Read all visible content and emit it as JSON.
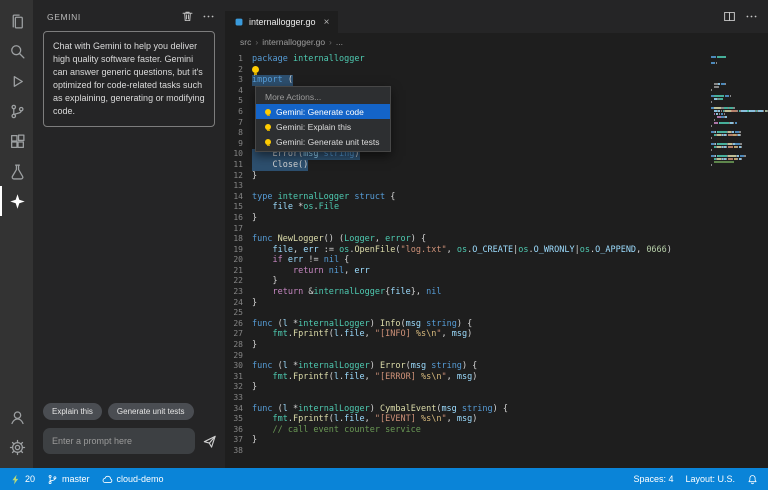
{
  "colors": {
    "status_bar": "#0a84d8",
    "menu_selection": "#1464c8",
    "selection": "#2d4f6e",
    "bulb": "#ffcc02",
    "bolt": "#b8d978",
    "go_badge": "#3a9bdc"
  },
  "activity_bar": {
    "items": [
      {
        "name": "explorer",
        "active": false
      },
      {
        "name": "search",
        "active": false
      },
      {
        "name": "run",
        "active": false
      },
      {
        "name": "source-control",
        "active": false
      },
      {
        "name": "extensions",
        "active": false
      },
      {
        "name": "testing",
        "active": false
      },
      {
        "name": "gemini-star",
        "active": true
      }
    ],
    "bottom_items": [
      {
        "name": "account",
        "active": false
      },
      {
        "name": "settings",
        "active": false
      }
    ]
  },
  "sidebar": {
    "title": "GEMINI",
    "header_icons": [
      "trash",
      "more"
    ],
    "description": "Chat with Gemini to help you deliver high quality software faster. Gemini can answer generic questions, but it's optimized for code-related tasks such as explaining, generating or modifying code.",
    "quick_actions": [
      "Explain this",
      "Generate unit tests"
    ],
    "prompt": {
      "placeholder": "Enter a prompt here",
      "value": ""
    }
  },
  "editor": {
    "tab": {
      "label": "internallogger.go",
      "close_glyph": "×"
    },
    "tab_actions": [
      "split-editor",
      "more"
    ],
    "breadcrumbs": [
      "src",
      "internallogger.go",
      "..."
    ],
    "context_menu": {
      "header": "More Actions...",
      "items": [
        {
          "label": "Gemini: Generate code",
          "icon": "lightbulb-icon",
          "selected": true
        },
        {
          "label": "Gemini: Explain this",
          "icon": "lightbulb-icon",
          "selected": false
        },
        {
          "label": "Gemini: Generate unit tests",
          "icon": "lightbulb-icon",
          "selected": false
        }
      ]
    },
    "code": {
      "language": "go",
      "lines": [
        {
          "tokens": [
            [
              "package",
              "kw"
            ],
            [
              " ",
              "pl"
            ],
            [
              "internallogger",
              "type"
            ]
          ]
        },
        {
          "bulb": true,
          "tokens": []
        },
        {
          "sel": true,
          "tokens": [
            [
              "import",
              "kw"
            ],
            [
              " (",
              "pl"
            ]
          ]
        },
        {
          "tokens": []
        },
        {
          "tokens": []
        },
        {
          "tokens": []
        },
        {
          "tokens": []
        },
        {
          "tokens": []
        },
        {
          "tokens": []
        },
        {
          "sel": true,
          "tokens": [
            [
              "    Error(",
              "pl"
            ],
            [
              "msg",
              "var"
            ],
            [
              " ",
              "pl"
            ],
            [
              "string",
              "kw"
            ],
            [
              ")",
              "pl"
            ]
          ]
        },
        {
          "sel": true,
          "tokens": [
            [
              "    Close()",
              "pl"
            ]
          ]
        },
        {
          "tokens": [
            [
              "}",
              "pl"
            ]
          ]
        },
        {
          "tokens": []
        },
        {
          "tokens": [
            [
              "type",
              "kw"
            ],
            [
              " ",
              "pl"
            ],
            [
              "internalLogger",
              "type"
            ],
            [
              " ",
              "pl"
            ],
            [
              "struct",
              "kw"
            ],
            [
              " {",
              "pl"
            ]
          ]
        },
        {
          "tokens": [
            [
              "    ",
              "pl"
            ],
            [
              "file",
              "var"
            ],
            [
              " *",
              "pl"
            ],
            [
              "os",
              "type"
            ],
            [
              ".",
              "pl"
            ],
            [
              "File",
              "type"
            ]
          ]
        },
        {
          "tokens": [
            [
              "}",
              "pl"
            ]
          ]
        },
        {
          "tokens": []
        },
        {
          "tokens": [
            [
              "func",
              "kw"
            ],
            [
              " ",
              "pl"
            ],
            [
              "NewLogger",
              "fn"
            ],
            [
              "() (",
              "pl"
            ],
            [
              "Logger",
              "type"
            ],
            [
              ", ",
              "pl"
            ],
            [
              "error",
              "type"
            ],
            [
              ") {",
              "pl"
            ]
          ]
        },
        {
          "tokens": [
            [
              "    ",
              "pl"
            ],
            [
              "file",
              "var"
            ],
            [
              ", ",
              "pl"
            ],
            [
              "err",
              "var"
            ],
            [
              " := ",
              "pl"
            ],
            [
              "os",
              "type"
            ],
            [
              ".",
              "pl"
            ],
            [
              "OpenFile",
              "fn"
            ],
            [
              "(",
              "pl"
            ],
            [
              "\"log.txt\"",
              "str"
            ],
            [
              ", ",
              "pl"
            ],
            [
              "os",
              "type"
            ],
            [
              ".",
              "pl"
            ],
            [
              "O_CREATE",
              "var"
            ],
            [
              "|",
              "pl"
            ],
            [
              "os",
              "type"
            ],
            [
              ".",
              "pl"
            ],
            [
              "O_WRONLY",
              "var"
            ],
            [
              "|",
              "pl"
            ],
            [
              "os",
              "type"
            ],
            [
              ".",
              "pl"
            ],
            [
              "O_APPEND",
              "var"
            ],
            [
              ", ",
              "pl"
            ],
            [
              "0666",
              "num"
            ],
            [
              ")",
              "pl"
            ]
          ]
        },
        {
          "tokens": [
            [
              "    ",
              "pl"
            ],
            [
              "if",
              "ctrl"
            ],
            [
              " ",
              "pl"
            ],
            [
              "err",
              "var"
            ],
            [
              " != ",
              "pl"
            ],
            [
              "nil",
              "kw"
            ],
            [
              " {",
              "pl"
            ]
          ]
        },
        {
          "tokens": [
            [
              "        ",
              "pl"
            ],
            [
              "return",
              "ctrl"
            ],
            [
              " ",
              "pl"
            ],
            [
              "nil",
              "kw"
            ],
            [
              ", ",
              "pl"
            ],
            [
              "err",
              "var"
            ]
          ]
        },
        {
          "tokens": [
            [
              "    }",
              "pl"
            ]
          ]
        },
        {
          "tokens": [
            [
              "    ",
              "pl"
            ],
            [
              "return",
              "ctrl"
            ],
            [
              " &",
              "pl"
            ],
            [
              "internalLogger",
              "type"
            ],
            [
              "{",
              "pl"
            ],
            [
              "file",
              "var"
            ],
            [
              "}, ",
              "pl"
            ],
            [
              "nil",
              "kw"
            ]
          ]
        },
        {
          "tokens": [
            [
              "}",
              "pl"
            ]
          ]
        },
        {
          "tokens": []
        },
        {
          "tokens": [
            [
              "func",
              "kw"
            ],
            [
              " (",
              "pl"
            ],
            [
              "l",
              "var"
            ],
            [
              " *",
              "pl"
            ],
            [
              "internalLogger",
              "type"
            ],
            [
              ") ",
              "pl"
            ],
            [
              "Info",
              "fn"
            ],
            [
              "(",
              "pl"
            ],
            [
              "msg",
              "var"
            ],
            [
              " ",
              "pl"
            ],
            [
              "string",
              "kw"
            ],
            [
              ") {",
              "pl"
            ]
          ]
        },
        {
          "tokens": [
            [
              "    ",
              "pl"
            ],
            [
              "fmt",
              "type"
            ],
            [
              ".",
              "pl"
            ],
            [
              "Fprintf",
              "fn"
            ],
            [
              "(",
              "pl"
            ],
            [
              "l",
              "var"
            ],
            [
              ".",
              "pl"
            ],
            [
              "file",
              "var"
            ],
            [
              ", ",
              "pl"
            ],
            [
              "\"[INFO] ",
              "str"
            ],
            [
              "%s\\n",
              "esc"
            ],
            [
              "\"",
              "str"
            ],
            [
              ", ",
              "pl"
            ],
            [
              "msg",
              "var"
            ],
            [
              ")",
              "pl"
            ]
          ]
        },
        {
          "tokens": [
            [
              "}",
              "pl"
            ]
          ]
        },
        {
          "tokens": []
        },
        {
          "tokens": [
            [
              "func",
              "kw"
            ],
            [
              " (",
              "pl"
            ],
            [
              "l",
              "var"
            ],
            [
              " *",
              "pl"
            ],
            [
              "internalLogger",
              "type"
            ],
            [
              ") ",
              "pl"
            ],
            [
              "Error",
              "fn"
            ],
            [
              "(",
              "pl"
            ],
            [
              "msg",
              "var"
            ],
            [
              " ",
              "pl"
            ],
            [
              "string",
              "kw"
            ],
            [
              ") {",
              "pl"
            ]
          ]
        },
        {
          "tokens": [
            [
              "    ",
              "pl"
            ],
            [
              "fmt",
              "type"
            ],
            [
              ".",
              "pl"
            ],
            [
              "Fprintf",
              "fn"
            ],
            [
              "(",
              "pl"
            ],
            [
              "l",
              "var"
            ],
            [
              ".",
              "pl"
            ],
            [
              "file",
              "var"
            ],
            [
              ", ",
              "pl"
            ],
            [
              "\"[ERROR] ",
              "str"
            ],
            [
              "%s\\n",
              "esc"
            ],
            [
              "\"",
              "str"
            ],
            [
              ", ",
              "pl"
            ],
            [
              "msg",
              "var"
            ],
            [
              ")",
              "pl"
            ]
          ]
        },
        {
          "tokens": [
            [
              "}",
              "pl"
            ]
          ]
        },
        {
          "tokens": []
        },
        {
          "tokens": [
            [
              "func",
              "kw"
            ],
            [
              " (",
              "pl"
            ],
            [
              "l",
              "var"
            ],
            [
              " *",
              "pl"
            ],
            [
              "internalLogger",
              "type"
            ],
            [
              ") ",
              "pl"
            ],
            [
              "CymbalEvent",
              "fn"
            ],
            [
              "(",
              "pl"
            ],
            [
              "msg",
              "var"
            ],
            [
              " ",
              "pl"
            ],
            [
              "string",
              "kw"
            ],
            [
              ") {",
              "pl"
            ]
          ]
        },
        {
          "tokens": [
            [
              "    ",
              "pl"
            ],
            [
              "fmt",
              "type"
            ],
            [
              ".",
              "pl"
            ],
            [
              "Fprintf",
              "fn"
            ],
            [
              "(",
              "pl"
            ],
            [
              "l",
              "var"
            ],
            [
              ".",
              "pl"
            ],
            [
              "file",
              "var"
            ],
            [
              ", ",
              "pl"
            ],
            [
              "\"[EVENT] ",
              "str"
            ],
            [
              "%s\\n",
              "esc"
            ],
            [
              "\"",
              "str"
            ],
            [
              ", ",
              "pl"
            ],
            [
              "msg",
              "var"
            ],
            [
              ")",
              "pl"
            ]
          ]
        },
        {
          "tokens": [
            [
              "    ",
              "pl"
            ],
            [
              "// call event counter service",
              "cmt"
            ]
          ]
        },
        {
          "tokens": [
            [
              "}",
              "pl"
            ]
          ]
        },
        {
          "tokens": []
        }
      ]
    }
  },
  "status_bar": {
    "left": [
      {
        "name": "cloud-code-status",
        "icon": "bolt",
        "label": "20"
      },
      {
        "name": "git-branch-status",
        "icon": "branch",
        "label": "master"
      },
      {
        "name": "cloud-workstation-status",
        "icon": "cloud",
        "label": "cloud-demo"
      }
    ],
    "right": [
      {
        "name": "spaces-status",
        "icon": "",
        "label": "Spaces: 4"
      },
      {
        "name": "layout-status",
        "icon": "",
        "label": "Layout: U.S."
      },
      {
        "name": "notifications-status",
        "icon": "bell",
        "label": ""
      }
    ]
  }
}
